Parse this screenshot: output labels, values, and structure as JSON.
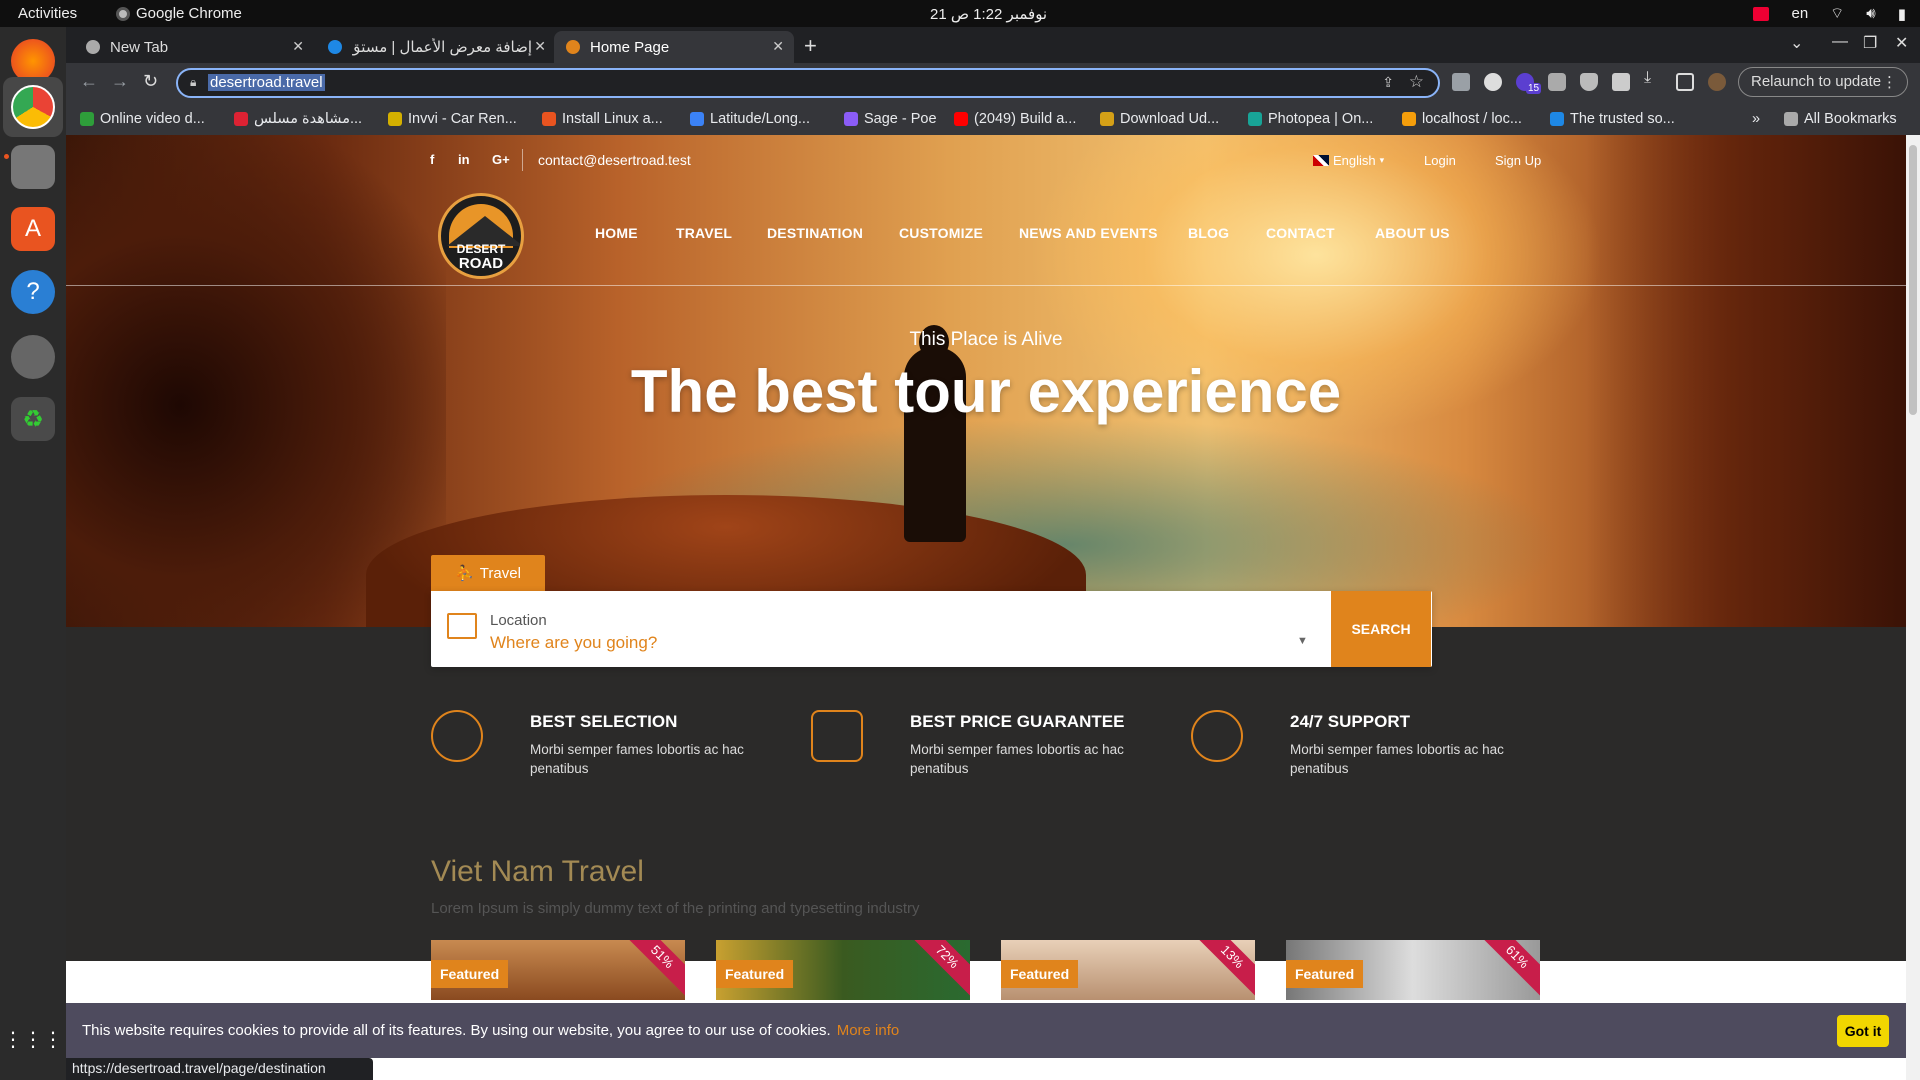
{
  "topbar": {
    "activities": "Activities",
    "app_name": "Google Chrome",
    "clock": "21 نوفمبر  1:22 ص",
    "lang": "en"
  },
  "chrome": {
    "tabs": [
      {
        "label": "New Tab"
      },
      {
        "label": "إضافة معرض الأعمال | مستق"
      },
      {
        "label": "Home Page"
      }
    ],
    "url": "desertroad.travel",
    "relaunch": "Relaunch to update",
    "extension_badge": "15",
    "bookmarks": [
      {
        "label": "Online video d...",
        "color": "#2e9e3a"
      },
      {
        "label": "مشاهدة مسلس...",
        "color": "#d23"
      },
      {
        "label": "Invvi - Car Ren...",
        "color": "#d4b000"
      },
      {
        "label": "Install Linux a...",
        "color": "#e95420"
      },
      {
        "label": "Latitude/Long...",
        "color": "#3b82f6"
      },
      {
        "label": "Sage - Poe",
        "color": "#8b5cf6"
      },
      {
        "label": "(2049) Build a...",
        "color": "#ff0000"
      },
      {
        "label": "Download Ud...",
        "color": "#d4a017"
      },
      {
        "label": "Photopea | On...",
        "color": "#18a497"
      },
      {
        "label": "localhost / loc...",
        "color": "#f59e0b"
      },
      {
        "label": "The trusted so...",
        "color": "#1e88e5"
      }
    ],
    "all_bookmarks": "All Bookmarks",
    "status_url": "https://desertroad.travel/page/destination"
  },
  "site": {
    "email": "contact@desertroad.test",
    "language": "English",
    "login": "Login",
    "signup": "Sign Up",
    "logo_line1": "DESERT",
    "logo_line2": "ROAD",
    "nav": [
      "HOME",
      "TRAVEL",
      "DESTINATION",
      "CUSTOMIZE",
      "NEWS AND EVENTS",
      "BLOG",
      "CONTACT",
      "ABOUT US"
    ],
    "tagline": "This Place is Alive",
    "headline": "The best tour experience",
    "search": {
      "tab_label": "Travel",
      "location_label": "Location",
      "placeholder": "Where are you going?",
      "button": "SEARCH"
    },
    "features": [
      {
        "title": "BEST SELECTION",
        "desc": "Morbi semper fames lobortis ac hac penatibus"
      },
      {
        "title": "BEST PRICE GUARANTEE",
        "desc": "Morbi semper fames lobortis ac hac penatibus"
      },
      {
        "title": "24/7 SUPPORT",
        "desc": "Morbi semper fames lobortis ac hac penatibus"
      }
    ],
    "section_title": "Viet Nam Travel",
    "section_sub": "Lorem Ipsum is simply dummy text of the printing and typesetting industry",
    "cards": [
      {
        "badge": "Featured",
        "discount": "51%",
        "bg": "linear-gradient(#c88a50,#8a4a20)"
      },
      {
        "badge": "Featured",
        "discount": "72%",
        "bg": "linear-gradient(90deg,#c8a030,#3a5a20,#2a6a30)"
      },
      {
        "badge": "Featured",
        "discount": "13%",
        "bg": "linear-gradient(#e8d0b8,#b89070)"
      },
      {
        "badge": "Featured",
        "discount": "61%",
        "bg": "linear-gradient(90deg,#777,#ddd,#999)"
      }
    ],
    "cookie": {
      "message": "This website requires cookies to provide all of its features. By using our website, you agree to our use of cookies.",
      "more_info": "More info",
      "button": "Got it"
    }
  },
  "colors": {
    "accent": "#e0841c",
    "title_gold": "#a38a54",
    "dark_band": "#2b2a29",
    "cookie_bar": "#4e4b5e"
  }
}
